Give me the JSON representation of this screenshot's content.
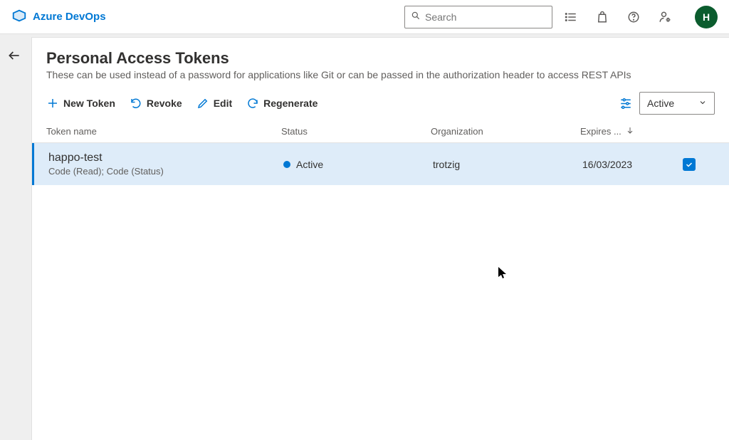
{
  "header": {
    "brand": "Azure DevOps",
    "search_placeholder": "Search",
    "avatar_initial": "H"
  },
  "page": {
    "title": "Personal Access Tokens",
    "subtitle": "These can be used instead of a password for applications like Git or can be passed in the authorization header to access REST APIs"
  },
  "toolbar": {
    "new_label": "New Token",
    "revoke_label": "Revoke",
    "edit_label": "Edit",
    "regenerate_label": "Regenerate",
    "filter_value": "Active"
  },
  "table": {
    "headers": {
      "name": "Token name",
      "status": "Status",
      "org": "Organization",
      "expires": "Expires ..."
    },
    "rows": [
      {
        "name": "happo-test",
        "scopes": "Code (Read); Code (Status)",
        "status": "Active",
        "org": "trotzig",
        "expires": "16/03/2023",
        "selected": true
      }
    ]
  }
}
